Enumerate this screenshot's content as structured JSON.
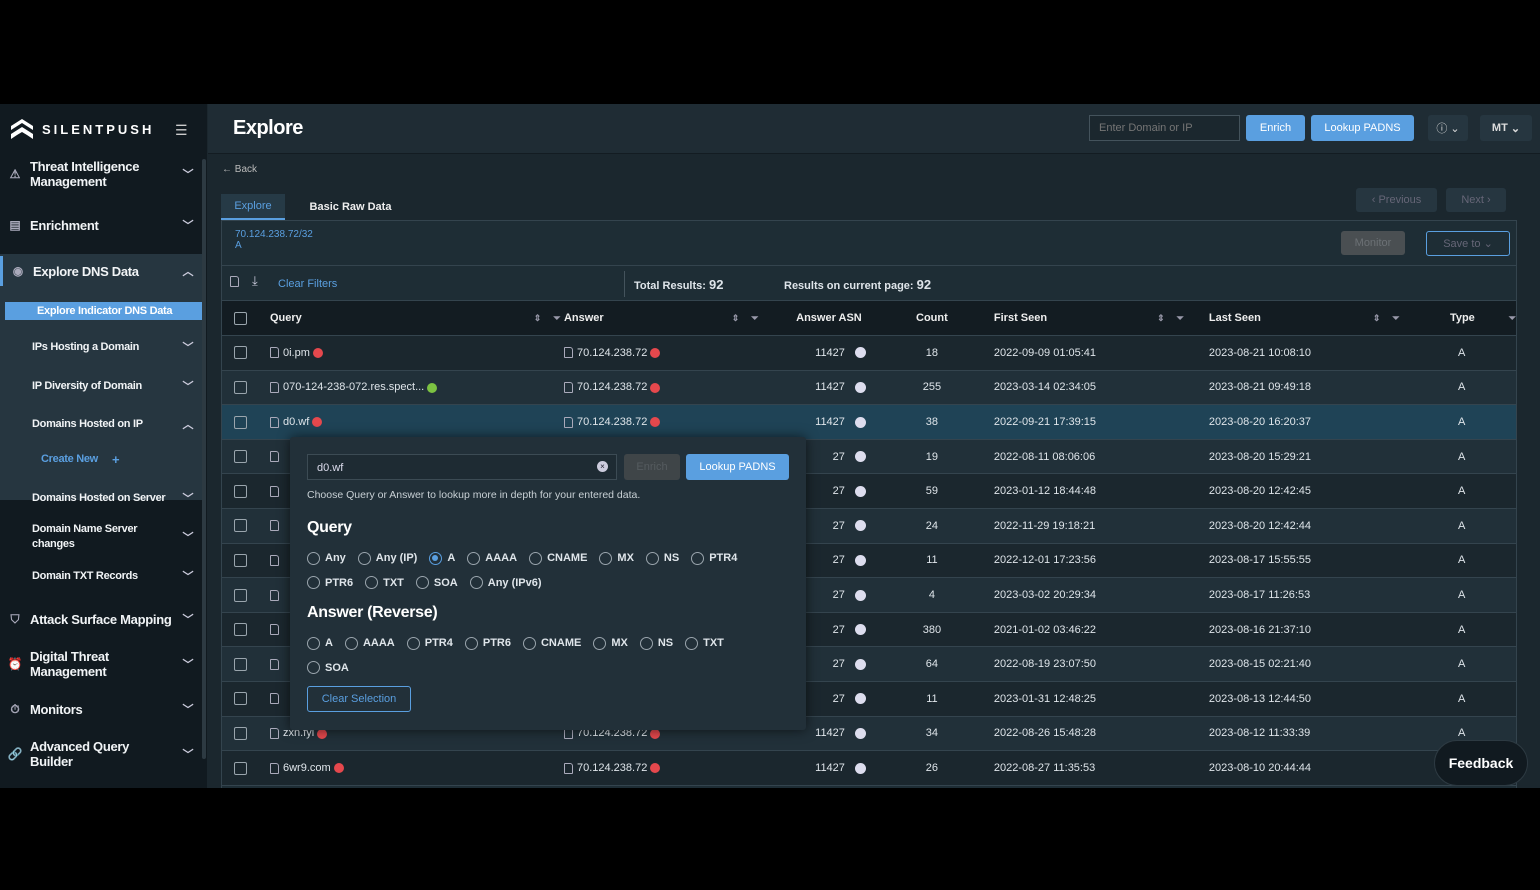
{
  "brand": "SILENTPUSH",
  "colors": {
    "accent": "#5a9fe0",
    "danger": "#e5484d",
    "ok": "#7cc242"
  },
  "sidebar": {
    "items": [
      {
        "label": "Threat Intelligence Management",
        "icon": "warning-icon"
      },
      {
        "label": "Enrichment",
        "icon": "enrichment-icon"
      },
      {
        "label": "Explore DNS Data",
        "icon": "compass-icon"
      },
      {
        "label": "Explore Indicator DNS Data"
      },
      {
        "label": "IPs Hosting a Domain"
      },
      {
        "label": "IP Diversity of Domain"
      },
      {
        "label": "Domains Hosted on IP"
      },
      {
        "label": "Create New"
      },
      {
        "label": "Domains Hosted on Server"
      },
      {
        "label": "Domain Name Server changes"
      },
      {
        "label": "Domain TXT Records"
      },
      {
        "label": "Attack Surface Mapping",
        "icon": "shield-icon"
      },
      {
        "label": "Digital Threat Management",
        "icon": "alarm-icon"
      },
      {
        "label": "Monitors",
        "icon": "stopwatch-icon"
      },
      {
        "label": "Advanced Query Builder",
        "icon": "link-icon"
      }
    ]
  },
  "header": {
    "title": "Explore",
    "search_placeholder": "Enter Domain or IP",
    "enrich": "Enrich",
    "lookup": "Lookup PADNS",
    "user": "MT"
  },
  "back": "Back",
  "tabs": [
    "Explore",
    "Basic Raw Data"
  ],
  "pager": {
    "prev": "Previous",
    "next": "Next"
  },
  "query_info": {
    "ip": "70.124.238.72/32",
    "type": "A"
  },
  "monitor": "Monitor",
  "save_to": "Save to",
  "toolbar": {
    "clear_filters": "Clear Filters",
    "total_label": "Total Results:",
    "total": "92",
    "page_label": "Results on current page:",
    "page": "92"
  },
  "columns": [
    "Query",
    "Answer",
    "Answer ASN",
    "Count",
    "First Seen",
    "Last Seen",
    "Type"
  ],
  "rows": [
    {
      "query": "0i.pm",
      "qs": "danger",
      "answer": "70.124.238.72",
      "asn": "11427",
      "count": "18",
      "first": "2022-09-09 01:05:41",
      "last": "2023-08-21 10:08:10",
      "type": "A"
    },
    {
      "query": "070-124-238-072.res.spect...",
      "qs": "ok",
      "answer": "70.124.238.72",
      "asn": "11427",
      "count": "255",
      "first": "2023-03-14 02:34:05",
      "last": "2023-08-21 09:49:18",
      "type": "A"
    },
    {
      "query": "d0.wf",
      "qs": "danger",
      "answer": "70.124.238.72",
      "asn": "11427",
      "count": "38",
      "first": "2022-09-21 17:39:15",
      "last": "2023-08-20 16:20:37",
      "type": "A"
    },
    {
      "query": "",
      "answer": "",
      "asn": "27",
      "count": "19",
      "first": "2022-08-11 08:06:06",
      "last": "2023-08-20 15:29:21",
      "type": "A"
    },
    {
      "query": "",
      "answer": "",
      "asn": "27",
      "count": "59",
      "first": "2023-01-12 18:44:48",
      "last": "2023-08-20 12:42:45",
      "type": "A"
    },
    {
      "query": "",
      "answer": "",
      "asn": "27",
      "count": "24",
      "first": "2022-11-29 19:18:21",
      "last": "2023-08-20 12:42:44",
      "type": "A"
    },
    {
      "query": "",
      "answer": "",
      "asn": "27",
      "count": "11",
      "first": "2022-12-01 17:23:56",
      "last": "2023-08-17 15:55:55",
      "type": "A"
    },
    {
      "query": "",
      "answer": "",
      "asn": "27",
      "count": "4",
      "first": "2023-03-02 20:29:34",
      "last": "2023-08-17 11:26:53",
      "type": "A"
    },
    {
      "query": "",
      "answer": "",
      "asn": "27",
      "count": "380",
      "first": "2021-01-02 03:46:22",
      "last": "2023-08-16 21:37:10",
      "type": "A"
    },
    {
      "query": "",
      "answer": "",
      "asn": "27",
      "count": "64",
      "first": "2022-08-19 23:07:50",
      "last": "2023-08-15 02:21:40",
      "type": "A"
    },
    {
      "query": "",
      "answer": "",
      "asn": "27",
      "count": "11",
      "first": "2023-01-31 12:48:25",
      "last": "2023-08-13 12:44:50",
      "type": "A"
    },
    {
      "query": "zxn.fyi",
      "qs": "danger",
      "answer": "70.124.238.72",
      "asn": "11427",
      "count": "34",
      "first": "2022-08-26 15:48:28",
      "last": "2023-08-12 11:33:39",
      "type": "A"
    },
    {
      "query": "6wr9.com",
      "qs": "danger",
      "answer": "70.124.238.72",
      "asn": "11427",
      "count": "26",
      "first": "2022-08-27 11:35:53",
      "last": "2023-08-10 20:44:44",
      "type": ""
    }
  ],
  "popup": {
    "value": "d0.wf",
    "enrich": "Enrich",
    "lookup": "Lookup PADNS",
    "hint": "Choose Query or Answer to lookup more in depth for your entered data.",
    "query_title": "Query",
    "query_opts": [
      "Any",
      "Any (IP)",
      "A",
      "AAAA",
      "CNAME",
      "MX",
      "NS",
      "PTR4",
      "PTR6",
      "TXT",
      "SOA",
      "Any (IPv6)"
    ],
    "query_selected": "A",
    "answer_title": "Answer (Reverse)",
    "answer_opts": [
      "A",
      "AAAA",
      "PTR4",
      "PTR6",
      "CNAME",
      "MX",
      "NS",
      "TXT",
      "SOA"
    ],
    "clear": "Clear Selection"
  },
  "feedback": "Feedback"
}
